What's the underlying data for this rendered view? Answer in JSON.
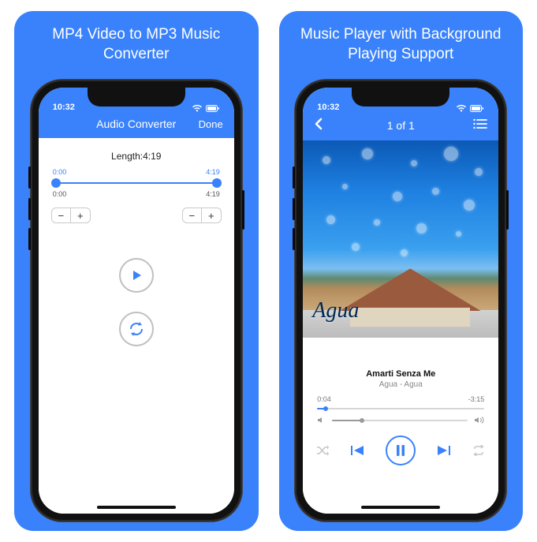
{
  "panels": {
    "left": {
      "title": "MP4 Video to MP3 Music Converter"
    },
    "right": {
      "title": "Music Player with Background Playing Support"
    }
  },
  "converter": {
    "status_time": "10:32",
    "nav_title": "Audio Converter",
    "nav_done": "Done",
    "length_label": "Length:4:19",
    "trim_start_label": "0:00",
    "trim_end_label": "4:19",
    "trim_start_time": "0:00",
    "trim_end_time": "4:19"
  },
  "player": {
    "status_time": "10:32",
    "nav_title": "1 of 1",
    "album_title": "Agua",
    "song_title": "Amarti Senza Me",
    "artist_line": "Agua - Agua",
    "elapsed": "0:04",
    "remaining": "-3:15"
  }
}
